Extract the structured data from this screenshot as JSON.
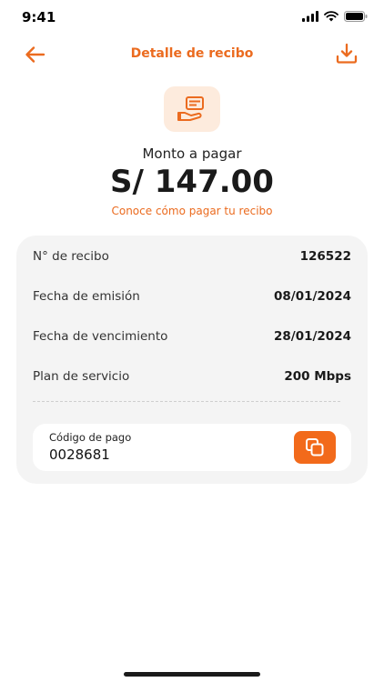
{
  "status_bar": {
    "time": "9:41",
    "icons": [
      "signal-icon",
      "wifi-icon",
      "battery-icon"
    ]
  },
  "header": {
    "title": "Detalle de recibo",
    "back_icon": "arrow-left-icon",
    "download_icon": "download-icon"
  },
  "summary": {
    "icon": "receipt-hand-icon",
    "amount_label": "Monto a pagar",
    "amount": "S/ 147.00",
    "pay_link": "Conoce cómo pagar tu recibo"
  },
  "details": {
    "rows": [
      {
        "label": "N° de recibo",
        "value": "126522"
      },
      {
        "label": "Fecha de emisión",
        "value": "08/01/2024"
      },
      {
        "label": "Fecha de vencimiento",
        "value": "28/01/2024"
      },
      {
        "label": "Plan de servicio",
        "value": "200 Mbps"
      }
    ],
    "payment_code": {
      "label": "Código de pago",
      "value": "0028681",
      "copy_icon": "copy-icon"
    }
  },
  "colors": {
    "accent": "#EB6B1F",
    "accent_button": "#F26A1B",
    "icon_bg": "#FDEBDD",
    "card_bg": "#F4F4F4"
  }
}
